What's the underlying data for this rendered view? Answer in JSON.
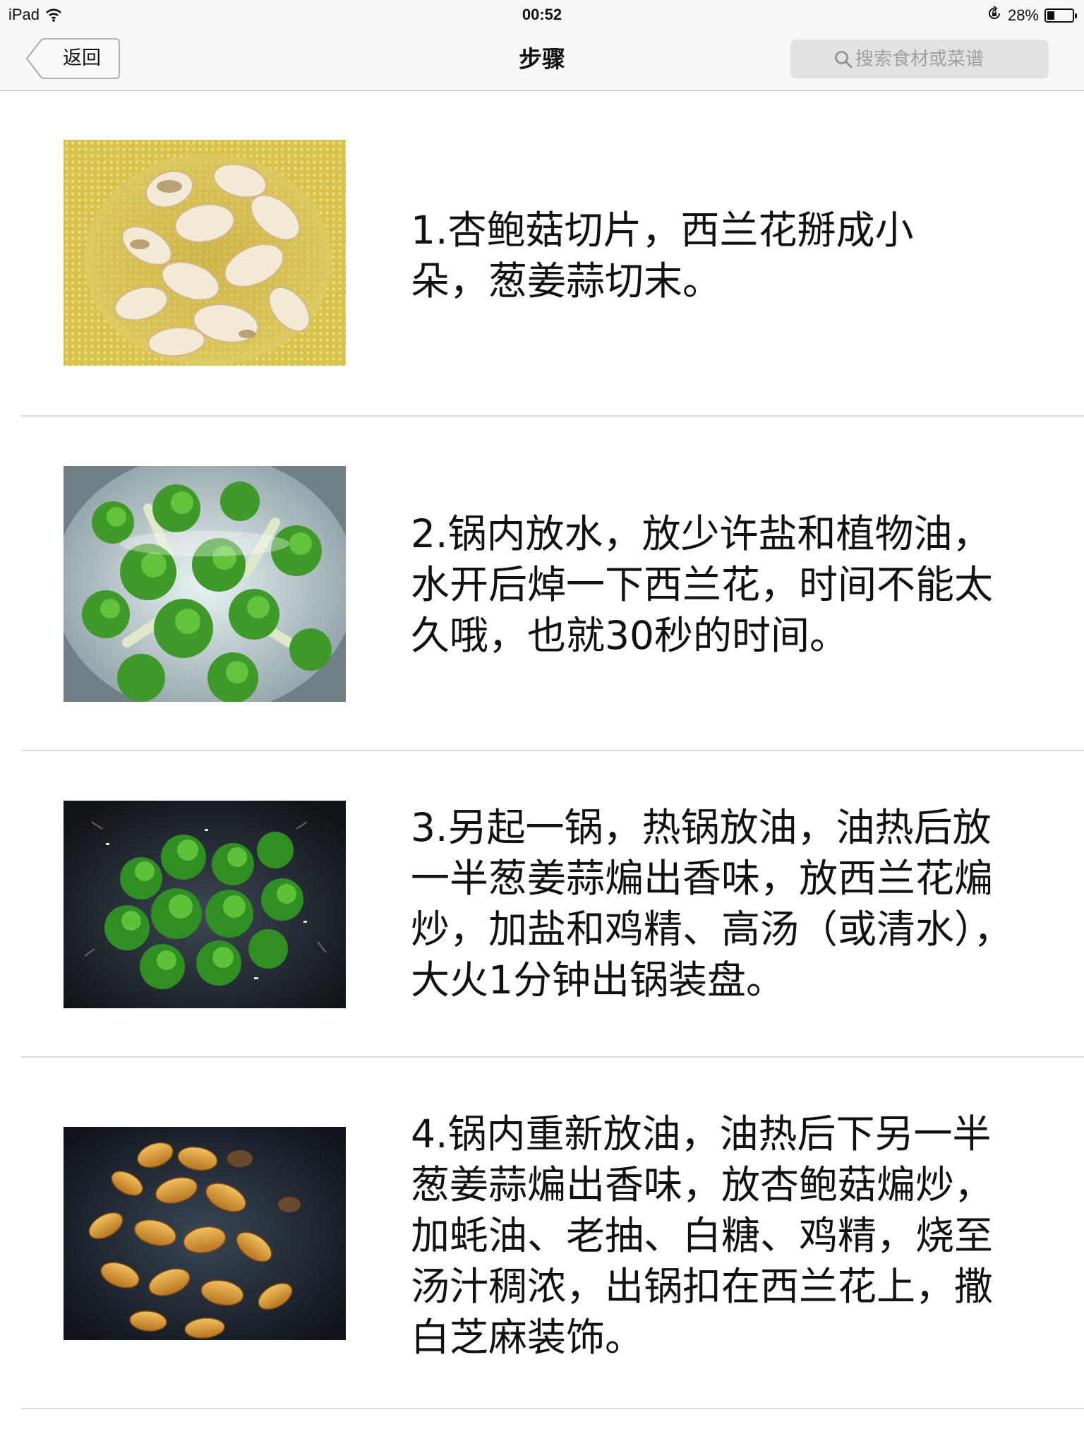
{
  "status_bar": {
    "device": "iPad",
    "time": "00:52",
    "battery_percent": "28%",
    "battery_level": 0.28,
    "icons": [
      "wifi-icon",
      "rotation-lock-icon",
      "battery-icon"
    ]
  },
  "nav": {
    "back_label": "返回",
    "title": "步骤",
    "search_placeholder": "搜索食材或菜谱"
  },
  "steps": [
    {
      "text": "1.杏鲍菇切片，西兰花掰成小朵，葱姜蒜切末。"
    },
    {
      "text": "2.锅内放水，放少许盐和植物油，水开后焯一下西兰花，时间不能太久哦，也就30秒的时间。"
    },
    {
      "text": "3.另起一锅，热锅放油，油热后放一半葱姜蒜煸出香味，放西兰花煸炒，加盐和鸡精、高汤（或清水），大火1分钟出锅装盘。"
    },
    {
      "text": "4.锅内重新放油，油热后下另一半葱姜蒜煸出香味，放杏鲍菇煸炒， 加蚝油、老抽、白糖、鸡精，烧至汤汁稠浓，出锅扣在西兰花上，撒白芝麻装饰。"
    }
  ],
  "colors": {
    "bar_background": "#f7f7f7",
    "divider": "#dcdcdc",
    "search_field": "#e2e2e3",
    "text": "#111111"
  }
}
